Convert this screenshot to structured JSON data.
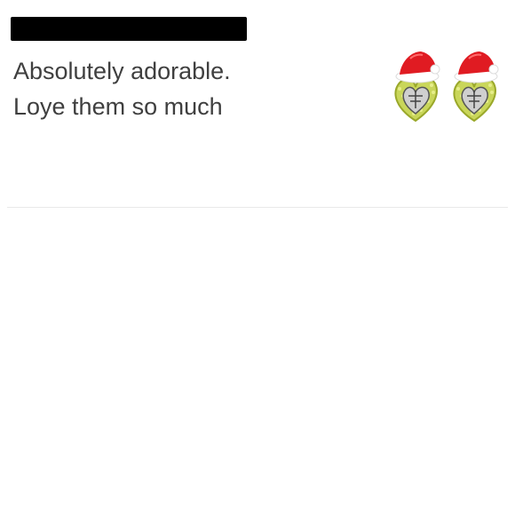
{
  "review": {
    "line1": "Absolutely adorable.",
    "line2": "Loye them so much"
  },
  "product_image": {
    "icon": "santa-hat-heart-earrings-icon"
  },
  "colors": {
    "text": "#3f3f3f",
    "redaction": "#000000",
    "hat_red": "#e01b22",
    "gem_green": "#b4c832"
  }
}
